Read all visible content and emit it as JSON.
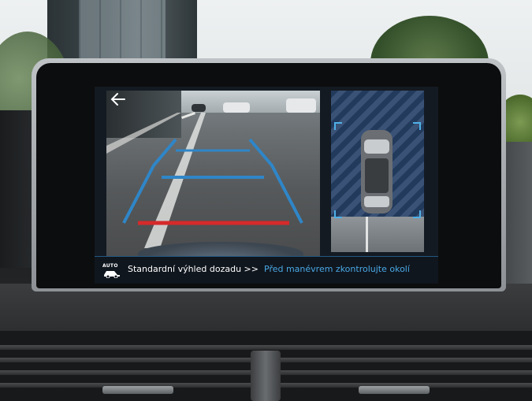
{
  "display": {
    "back_icon": "back-arrow-icon",
    "status_bar": {
      "mode_badge": "AUTO",
      "mode_icon": "car-camera-icon",
      "view_mode_label": "Standardní výhled dozadu >>",
      "warning_text": "Před manévrem zkontrolujte okolí"
    },
    "camera_view": {
      "guide_colors": {
        "distance_lines": "#2f86c8",
        "stop_line": "#d62a2a"
      }
    },
    "top_view": {
      "sensor_bracket_color": "#4fb0e8",
      "car_icon": "car-top-view-icon"
    }
  }
}
